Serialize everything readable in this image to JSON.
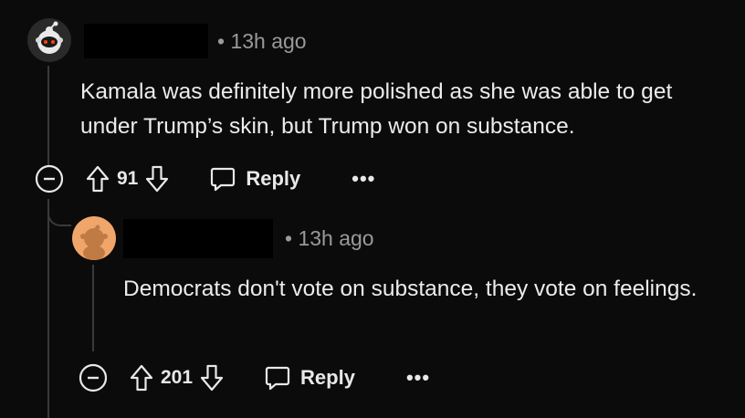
{
  "comments": [
    {
      "username": "",
      "time": "• 13h ago",
      "body": "Kamala was definitely more polished as she was able to get under Trump’s skin, but Trump won on substance.",
      "votes": "91",
      "reply_label": "Reply",
      "more_label": "•••"
    },
    {
      "username": "",
      "time": "• 13h ago",
      "body": "Democrats don't vote on substance, they vote on feelings.",
      "votes": "201",
      "reply_label": "Reply",
      "more_label": "•••"
    }
  ],
  "colors": {
    "background": "#0b0b0b",
    "text": "#ececec",
    "muted": "#9a9a9a",
    "thread_line": "#3a3a3a",
    "avatar2_bg": "#f0a66a"
  },
  "icons": [
    "collapse-icon",
    "upvote-icon",
    "downvote-icon",
    "reply-icon",
    "more-icon",
    "snoo-avatar-icon"
  ]
}
